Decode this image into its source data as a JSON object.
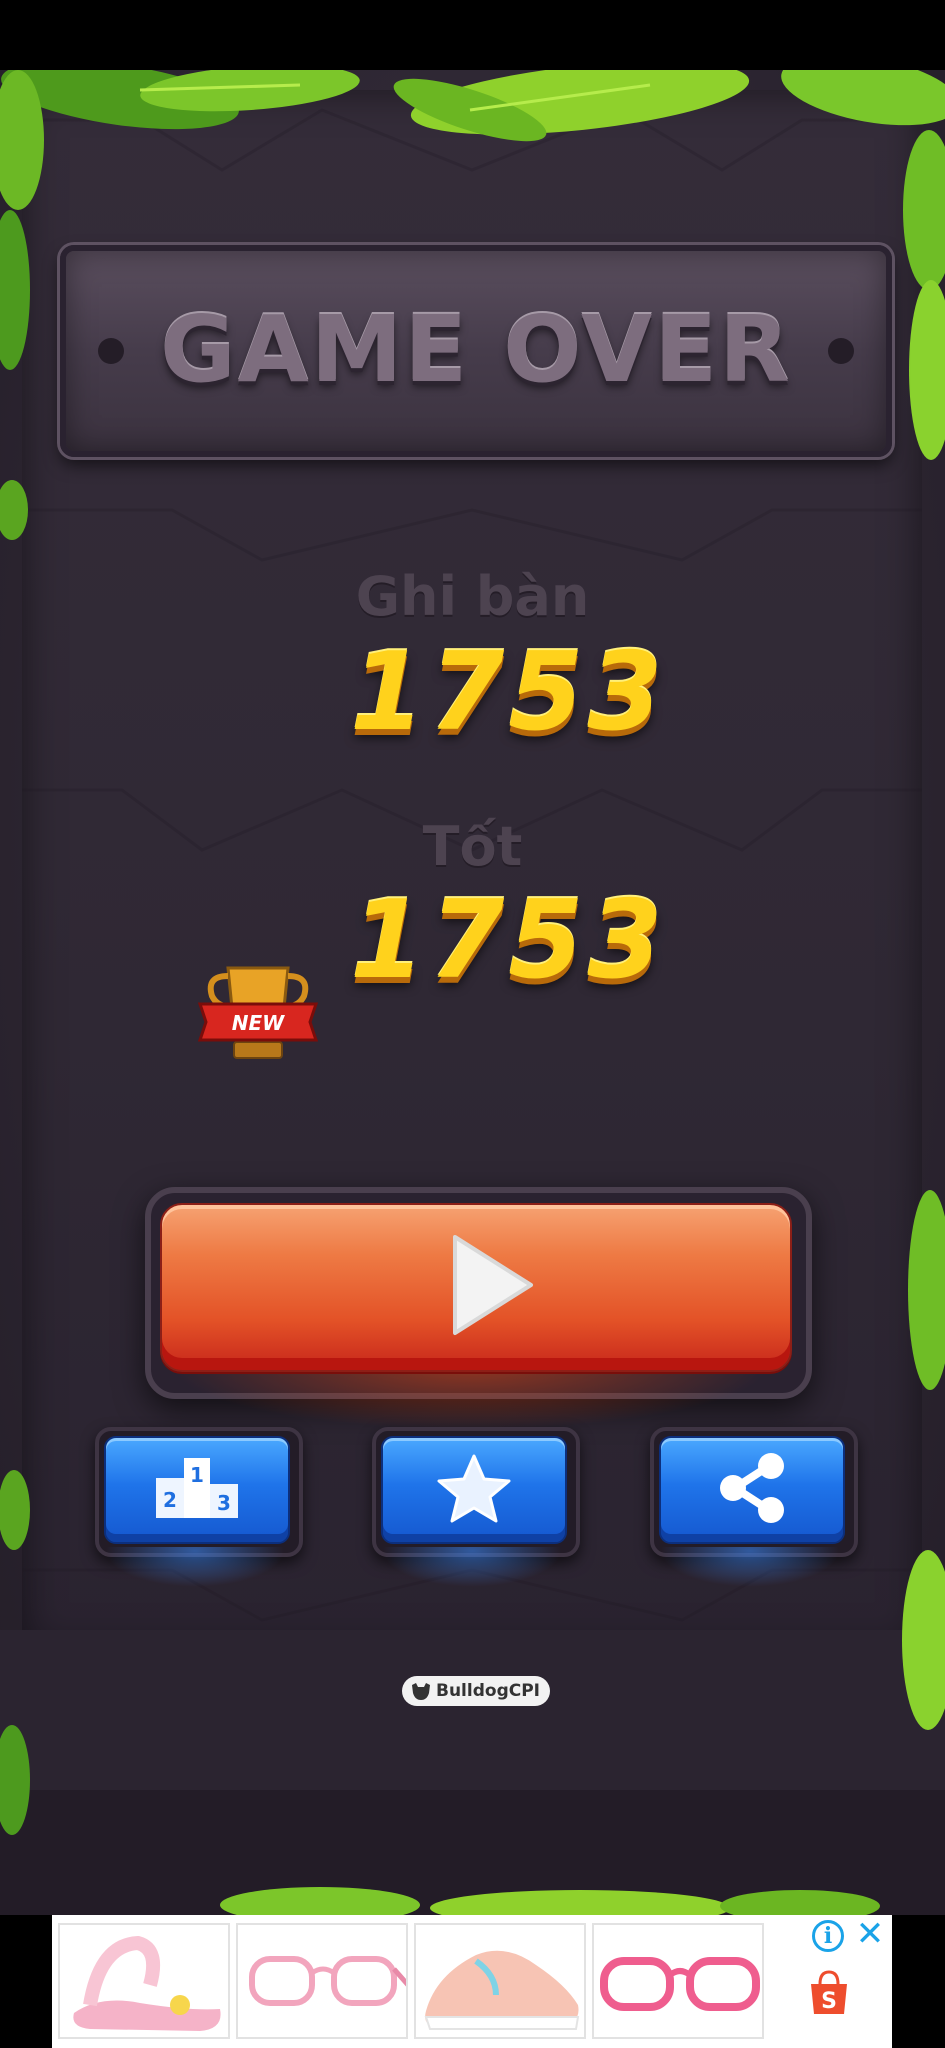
{
  "title": "GAME OVER",
  "score": {
    "label": "Ghi bàn",
    "value": "1753"
  },
  "best": {
    "label": "Tốt",
    "value": "1753",
    "badge": "NEW"
  },
  "buttons": {
    "play": "play-icon",
    "leaderboard": "podium-icon",
    "rate": "star-icon",
    "share": "share-icon"
  },
  "watermark": "BulldogCPI",
  "ad": {
    "info": "i",
    "close": "✕",
    "shop_letter": "S",
    "items": [
      "pink sandal",
      "pink glasses",
      "pink sneaker",
      "pink glasses"
    ]
  },
  "colors": {
    "score": "#ffd21c",
    "play_button": "#e35227",
    "small_button": "#1f74ea",
    "ad_accent": "#1aa3e8",
    "shopee": "#ee4d2d"
  }
}
